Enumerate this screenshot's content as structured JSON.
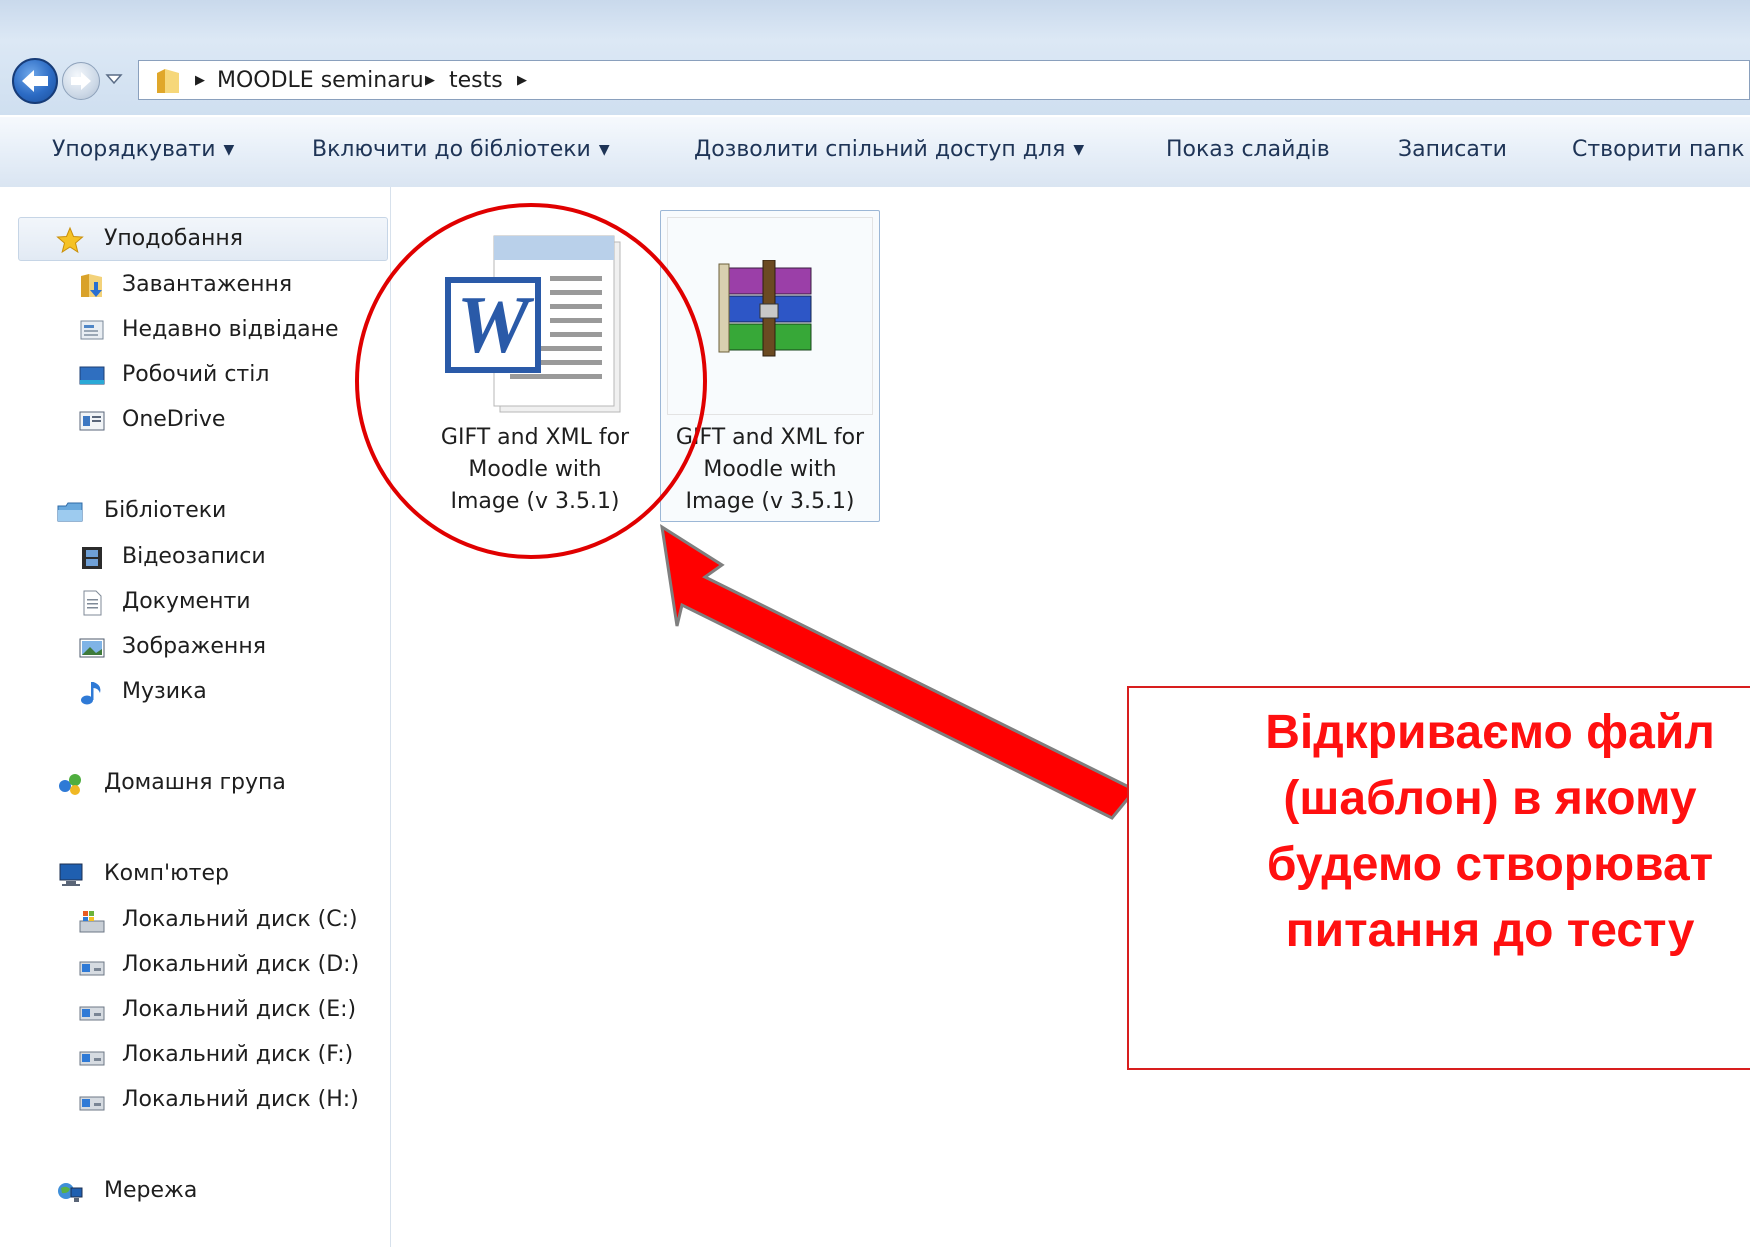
{
  "breadcrumb": {
    "items": [
      "MOODLE seminaru",
      "tests"
    ]
  },
  "toolbar": {
    "items": [
      {
        "label": "Упорядкувати",
        "dropdown": true
      },
      {
        "label": "Включити до бібліотеки",
        "dropdown": true
      },
      {
        "label": "Дозволити спільний доступ для",
        "dropdown": true
      },
      {
        "label": "Показ слайдів",
        "dropdown": false
      },
      {
        "label": "Записати",
        "dropdown": false
      },
      {
        "label": "Створити папк",
        "dropdown": false
      }
    ]
  },
  "sidebar": {
    "favorites": {
      "header": "Уподобання",
      "icon": "star-icon",
      "items": [
        {
          "label": "Завантаження",
          "icon": "downloads-folder-icon"
        },
        {
          "label": "Недавно відвідане",
          "icon": "recent-places-icon"
        },
        {
          "label": "Робочий стіл",
          "icon": "desktop-icon"
        },
        {
          "label": "OneDrive",
          "icon": "onedrive-icon"
        }
      ]
    },
    "libraries": {
      "header": "Бібліотеки",
      "icon": "libraries-icon",
      "items": [
        {
          "label": "Відеозаписи",
          "icon": "videos-icon"
        },
        {
          "label": "Документи",
          "icon": "documents-icon"
        },
        {
          "label": "Зображення",
          "icon": "pictures-icon"
        },
        {
          "label": "Музика",
          "icon": "music-icon"
        }
      ]
    },
    "homegroup": {
      "label": "Домашня група",
      "icon": "homegroup-icon"
    },
    "computer": {
      "header": "Комп'ютер",
      "icon": "computer-icon",
      "items": [
        {
          "label": "Локальний диск (C:)",
          "icon": "system-drive-icon"
        },
        {
          "label": "Локальний диск (D:)",
          "icon": "drive-icon"
        },
        {
          "label": "Локальний диск (E:)",
          "icon": "drive-icon"
        },
        {
          "label": "Локальний диск (F:)",
          "icon": "drive-icon"
        },
        {
          "label": "Локальний диск (H:)",
          "icon": "drive-icon"
        }
      ]
    },
    "network": {
      "label": "Мережа",
      "icon": "network-icon"
    }
  },
  "files": [
    {
      "name_lines": [
        "GIFT and XML for",
        "Moodle with",
        "Image (v 3.5.1)"
      ],
      "icon": "word-document-icon",
      "selected": false
    },
    {
      "name_lines": [
        "GIFT and XML for",
        "Moodle with",
        "Image (v 3.5.1)"
      ],
      "icon": "winrar-archive-icon",
      "selected": true
    }
  ],
  "annotation": {
    "lines": [
      "Відкриваємо файл",
      "(шаблон) в якому",
      "будемо створюват",
      "питання до тесту"
    ],
    "color": "#ff1010"
  },
  "colors": {
    "accent_red": "#e00000",
    "toolbar_text": "#1e3456"
  }
}
